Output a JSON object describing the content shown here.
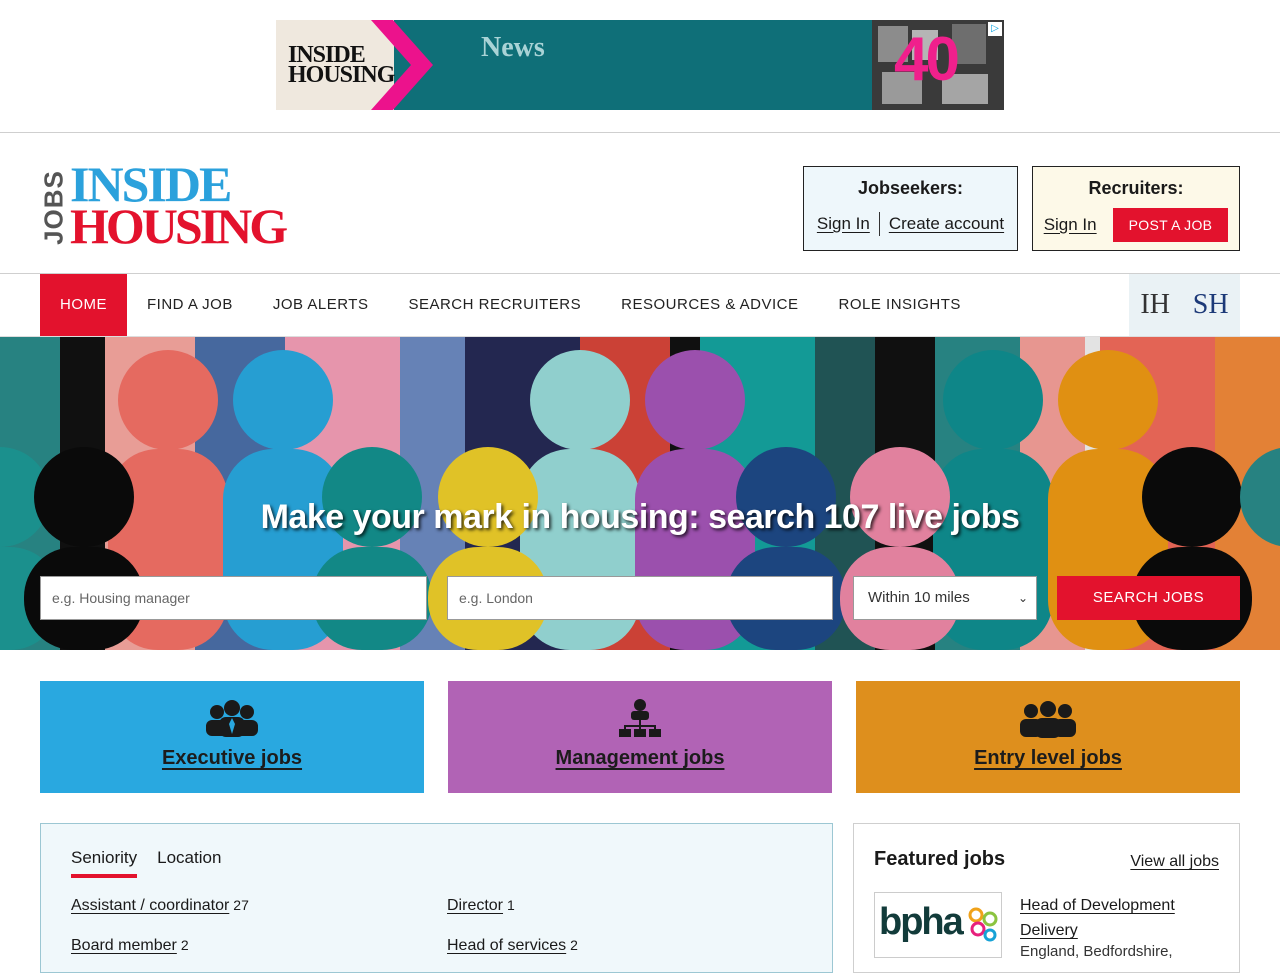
{
  "ad": {
    "brand_line1": "INSIDE",
    "brand_line2": "HOUSING",
    "headline": "News",
    "badge": "40",
    "choices_icon": "adchoices-icon"
  },
  "logo": {
    "jobs": "JOBS",
    "inside": "INSIDE",
    "housing": "HOUSING"
  },
  "jobseekers": {
    "title": "Jobseekers:",
    "sign_in": "Sign In",
    "create_account": "Create account"
  },
  "recruiters": {
    "title": "Recruiters:",
    "sign_in": "Sign In",
    "post_job": "POST A JOB"
  },
  "nav": {
    "items": [
      {
        "label": "HOME"
      },
      {
        "label": "FIND A JOB"
      },
      {
        "label": "JOB ALERTS"
      },
      {
        "label": "SEARCH RECRUITERS"
      },
      {
        "label": "RESOURCES & ADVICE"
      },
      {
        "label": "ROLE INSIGHTS"
      }
    ],
    "brand_ih": "IH",
    "brand_sh": "SH"
  },
  "hero": {
    "title": "Make your mark in housing: search 107 live jobs",
    "keywords_placeholder": "e.g. Housing manager",
    "location_placeholder": "e.g. London",
    "radius_selected": "Within 10 miles",
    "search_button": "SEARCH JOBS"
  },
  "tiles": [
    {
      "label": "Executive jobs",
      "icon": "executive-group-icon"
    },
    {
      "label": "Management jobs",
      "icon": "org-chart-icon"
    },
    {
      "label": "Entry level jobs",
      "icon": "team-group-icon"
    }
  ],
  "browse": {
    "tabs": [
      "Seniority",
      "Location"
    ],
    "links": [
      {
        "label": "Assistant / coordinator",
        "count": "27"
      },
      {
        "label": "Director",
        "count": "1"
      },
      {
        "label": "Board member",
        "count": "2"
      },
      {
        "label": "Head of services",
        "count": "2"
      }
    ]
  },
  "featured": {
    "title": "Featured jobs",
    "view_all": "View all jobs",
    "logo_text": "bpha",
    "job_title": "Head of Development Delivery",
    "job_location": "England, Bedfordshire,"
  },
  "colors": {
    "brand_red": "#e3122d",
    "brand_blue": "#2ba1dc",
    "executive": "#29a8e0",
    "management": "#b163b5",
    "entry": "#de8f1d"
  }
}
